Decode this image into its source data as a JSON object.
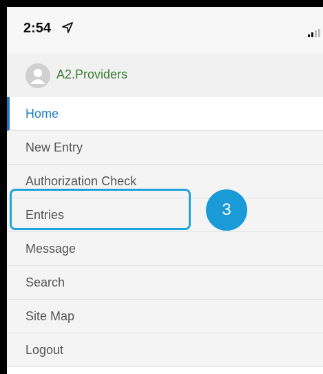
{
  "status_bar": {
    "time": "2:54",
    "icons": [
      "location-arrow-icon",
      "signal-bars-icon"
    ]
  },
  "header": {
    "avatar_icon": "user-avatar-icon",
    "provider_name": "A2.Providers"
  },
  "menu": {
    "items": [
      {
        "label": "Home",
        "active": true
      },
      {
        "label": "New Entry"
      },
      {
        "label": "Authorization Check"
      },
      {
        "label": "Entries",
        "highlighted": true
      },
      {
        "label": "Message"
      },
      {
        "label": "Search"
      },
      {
        "label": "Site Map"
      },
      {
        "label": "Logout"
      }
    ]
  },
  "callout": {
    "number": "3",
    "color": "#1a9ad6"
  },
  "colors": {
    "active_item": "#1e7bc7",
    "provider_name": "#3a7d34",
    "highlight_border": "#1fa3dc"
  }
}
